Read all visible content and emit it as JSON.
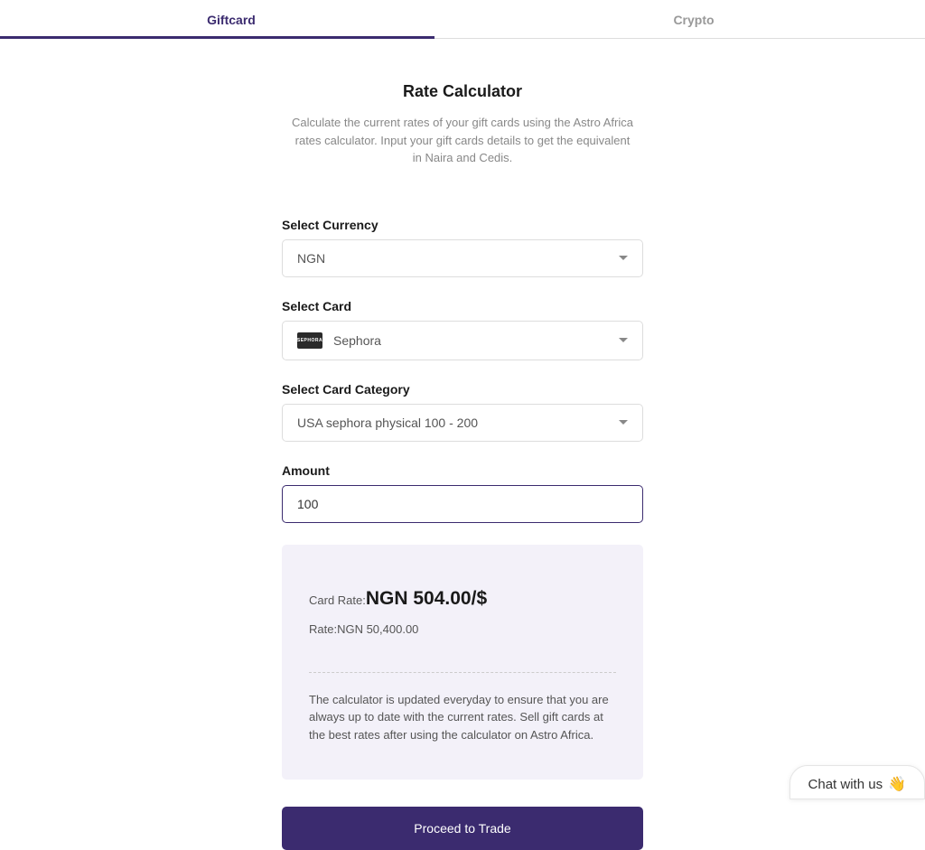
{
  "tabs": {
    "giftcard": "Giftcard",
    "crypto": "Crypto"
  },
  "header": {
    "title": "Rate Calculator",
    "subtitle": "Calculate the current rates of your gift cards using the Astro Africa rates calculator. Input your gift cards details to get the equivalent in Naira and Cedis."
  },
  "form": {
    "currency_label": "Select Currency",
    "currency_value": "NGN",
    "card_label": "Select Card",
    "card_value": "Sephora",
    "category_label": "Select Card Category",
    "category_value": "USA sephora physical 100 - 200",
    "amount_label": "Amount",
    "amount_value": "100"
  },
  "result": {
    "card_rate_label": "Card Rate:",
    "card_rate_value": "NGN 504.00/$",
    "rate_label": "Rate:",
    "rate_value": "NGN 50,400.00",
    "disclaimer": "The calculator is updated everyday to ensure that you are always up to date with the current rates. Sell gift cards at the best rates after using the calculator on Astro Africa."
  },
  "proceed_label": "Proceed to Trade",
  "chat": {
    "label": "Chat with us",
    "emoji": "👋"
  }
}
